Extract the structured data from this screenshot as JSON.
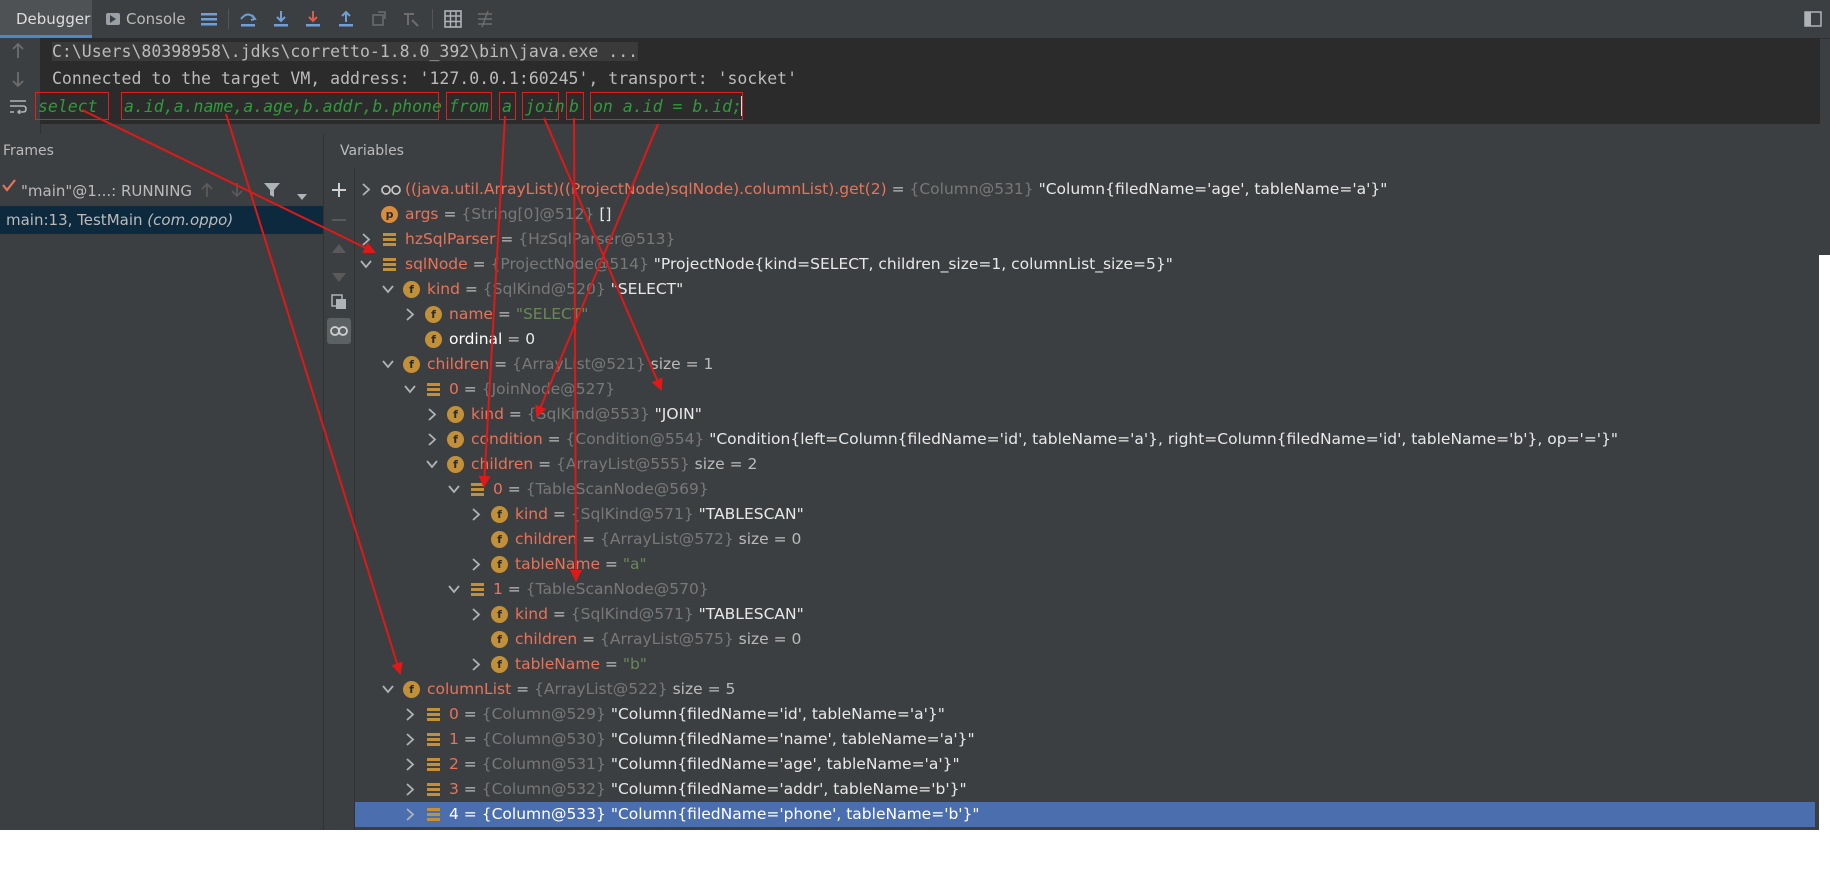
{
  "toolbar": {
    "tabs": [
      {
        "label": "Debugger"
      },
      {
        "label": "Console"
      }
    ]
  },
  "console": {
    "lines": [
      "C:\\Users\\80398958\\.jdks\\corretto-1.8.0_392\\bin\\java.exe ...",
      "Connected to the target VM, address: '127.0.0.1:60245', transport: 'socket'"
    ],
    "sql_tokens": [
      "select",
      "a.id,a.name,a.age,b.addr,b.phone",
      "from",
      "a",
      "join",
      "b",
      "on a.id = b.id;"
    ]
  },
  "frames": {
    "title": "Frames",
    "thread": "\"main\"@1...: RUNNING",
    "frame_text": "main:13, TestMain",
    "frame_pkg": "(com.oppo)"
  },
  "variables": {
    "title": "Variables",
    "rows": [
      {
        "name": "((java.util.ArrayList)((ProjectNode)sqlNode).columnList).get(2)",
        "type": "{Column@531}",
        "value": "\"Column{filedName='age', tableName='a'}\""
      },
      {
        "name": "args",
        "type": "{String[0]@512}",
        "value": "[]"
      },
      {
        "name": "hzSqlParser",
        "type": "{HzSqlParser@513}",
        "value": ""
      },
      {
        "name": "sqlNode",
        "type": "{ProjectNode@514}",
        "value": "\"ProjectNode{kind=SELECT, children_size=1, columnList_size=5}\""
      },
      {
        "name": "kind",
        "type": "{SqlKind@520}",
        "value": "\"SELECT\""
      },
      {
        "name": "name",
        "value": "\"SELECT\""
      },
      {
        "name": "ordinal",
        "value": "0"
      },
      {
        "name": "children",
        "type": "{ArrayList@521}",
        "value": "size = 1"
      },
      {
        "name": "0",
        "type": "{JoinNode@527}",
        "value": ""
      },
      {
        "name": "kind",
        "type": "{SqlKind@553}",
        "value": "\"JOIN\""
      },
      {
        "name": "condition",
        "type": "{Condition@554}",
        "value": "\"Condition{left=Column{filedName='id', tableName='a'}, right=Column{filedName='id', tableName='b'}, op='='}\""
      },
      {
        "name": "children",
        "type": "{ArrayList@555}",
        "value": "size = 2"
      },
      {
        "name": "0",
        "type": "{TableScanNode@569}",
        "value": ""
      },
      {
        "name": "kind",
        "type": "{SqlKind@571}",
        "value": "\"TABLESCAN\""
      },
      {
        "name": "children",
        "type": "{ArrayList@572}",
        "value": "size = 0"
      },
      {
        "name": "tableName",
        "value": "\"a\""
      },
      {
        "name": "1",
        "type": "{TableScanNode@570}",
        "value": ""
      },
      {
        "name": "kind",
        "type": "{SqlKind@571}",
        "value": "\"TABLESCAN\""
      },
      {
        "name": "children",
        "type": "{ArrayList@575}",
        "value": "size = 0"
      },
      {
        "name": "tableName",
        "value": "\"b\""
      },
      {
        "name": "columnList",
        "type": "{ArrayList@522}",
        "value": "size = 5"
      },
      {
        "name": "0",
        "type": "{Column@529}",
        "value": "\"Column{filedName='id', tableName='a'}\""
      },
      {
        "name": "1",
        "type": "{Column@530}",
        "value": "\"Column{filedName='name', tableName='a'}\""
      },
      {
        "name": "2",
        "type": "{Column@531}",
        "value": "\"Column{filedName='age', tableName='a'}\""
      },
      {
        "name": "3",
        "type": "{Column@532}",
        "value": "\"Column{filedName='addr', tableName='b'}\""
      },
      {
        "name": "4",
        "type": "{Column@533}",
        "value": "\"Column{filedName='phone', tableName='b'}\""
      }
    ]
  },
  "colors": {
    "background": "#3c3f41",
    "console_bg": "#2b2b2b",
    "selection": "#4b6eaf",
    "annotation_red": "#e02020",
    "sql_green": "#2f9a3a",
    "field_orange": "#c3903a"
  }
}
